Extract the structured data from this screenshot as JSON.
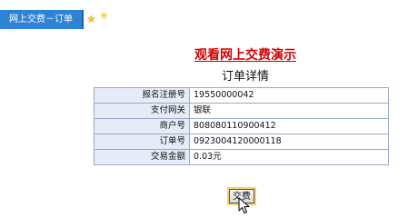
{
  "tab": {
    "label": "网上交费－订单"
  },
  "header": {
    "demo_title": "观看网上交费演示",
    "order_title": "订单详情"
  },
  "order_details": [
    {
      "label": "报名注册号",
      "value": "19550000042"
    },
    {
      "label": "支付网关",
      "value": "银联"
    },
    {
      "label": "商户号",
      "value": "808080110900412"
    },
    {
      "label": "订单号",
      "value": "0923004120000118"
    },
    {
      "label": "交易金额",
      "value": "0.03元"
    }
  ],
  "actions": {
    "pay_label": "交费"
  },
  "colors": {
    "tab_background": "#2f83d6",
    "demo_title": "#d20000",
    "label_cell_background": "#e6ecf7",
    "table_border": "#9aa9c6",
    "star": "#f3c12a"
  },
  "icons": [
    "star-icon",
    "mouse-pointer-icon"
  ]
}
